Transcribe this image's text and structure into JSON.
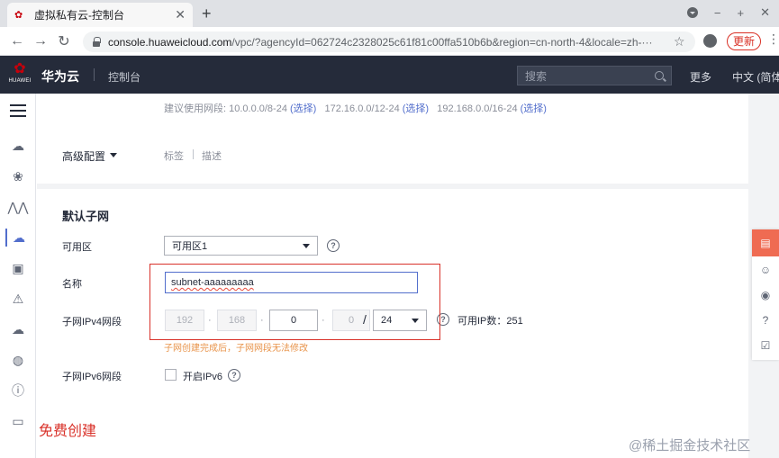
{
  "browser": {
    "tab_title": "虚拟私有云-控制台",
    "tab_close": "✕",
    "new_tab": "+",
    "url_host": "console.huaweicloud.com",
    "url_path": "/vpc/?agencyId=062724c2328025c61f81c00ffa510b6b&region=cn-north-4&locale=zh-···",
    "update_label": "更新",
    "back_icon": "←",
    "forward_icon": "→",
    "reload_icon": "↻",
    "star_icon": "☆",
    "kebab_icon": "⋮",
    "win_min": "−",
    "win_max": "+",
    "win_close": "✕"
  },
  "topbar": {
    "brand_mark": "HUAWEI",
    "product_name": "华为云",
    "console_label": "控制台",
    "search_placeholder": "搜索",
    "more_label": "更多",
    "language_label": "中文 (简体"
  },
  "sidebar": {
    "icons": [
      "cloud-server-icon",
      "cluster-icon",
      "cdn-icon",
      "vpc-icon",
      "database-icon",
      "alert-icon",
      "cloud-network-icon",
      "globe-icon",
      "ip-icon",
      "storage-icon"
    ]
  },
  "form": {
    "cidr_hint": "建议使用网段: 10.0.0.0/8-24",
    "cidr_hint_2": "172.16.0.0/12-24",
    "cidr_hint_3": "192.168.0.0/16-24",
    "select_link": "(选择)",
    "advanced_label": "高级配置",
    "tags_label": "标签",
    "desc_label": "描述",
    "section_title": "默认子网",
    "az_label": "可用区",
    "az_value": "可用区1",
    "name_label": "名称",
    "name_value": "subnet-aaaaaaaaa",
    "ipv4_label": "子网IPv4网段",
    "octet1": "192",
    "octet2": "168",
    "octet3": "0",
    "octet4": "0",
    "dot": "·",
    "slash": "/",
    "mask_value": "24",
    "available_ip_label": "可用IP数：251",
    "warning_text": "子网创建完成后，子网网段无法修改",
    "ipv6_label": "子网IPv6网段",
    "ipv6_checkbox_label": "开启IPv6",
    "help_mark": "?"
  },
  "annotation": {
    "free_create": "免费创建",
    "watermark": "@稀土掘金技术社区"
  },
  "colors": {
    "accent": "#526ecc",
    "annotation_red": "#d9322a",
    "warning_orange": "#e8934a",
    "topbar_bg": "#252b3a"
  }
}
